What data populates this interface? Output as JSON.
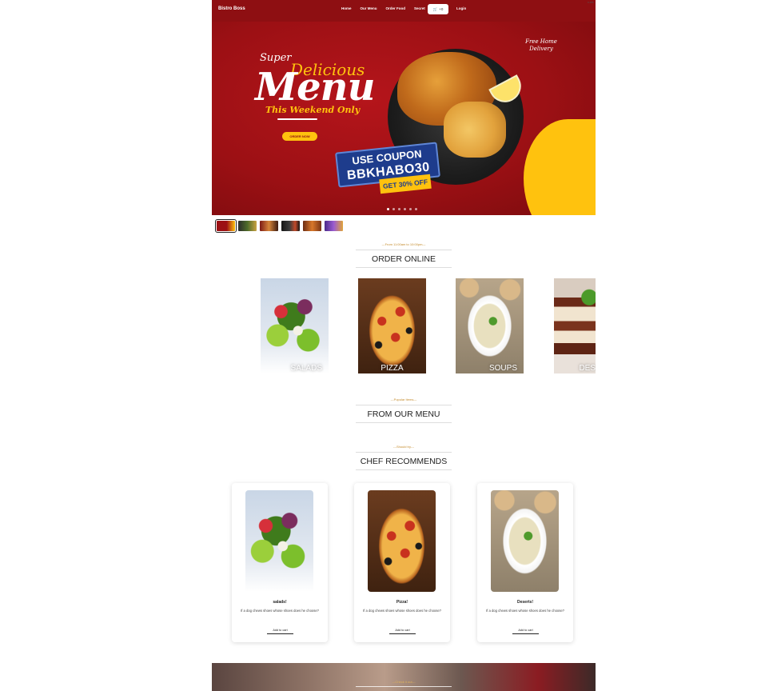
{
  "navbar": {
    "brand": "Bistro Boss",
    "links": [
      "Home",
      "Our Menu",
      "Order Food",
      "Secret"
    ],
    "cart_label": "+0",
    "login_label": "Login",
    "corner_tag": "0 485"
  },
  "hero": {
    "super": "Super",
    "delicious": "Delicious",
    "menu": "Menu",
    "weekend": "This Weekend Only",
    "order_now": "ORDER NOW",
    "free_delivery": "Free Home Delivery",
    "coupon_line1": "USE COUPON",
    "coupon_line2": "BBKHABO30",
    "off_tag": "GET 30% OFF",
    "slides_count": 6,
    "active_slide": 1
  },
  "order_online": {
    "pre": "---From 11:00am to 10:00pm---",
    "title": "ORDER ONLINE",
    "categories": [
      {
        "label": "SALADS",
        "image": "salad"
      },
      {
        "label": "PIZZA",
        "image": "pizza"
      },
      {
        "label": "SOUPS",
        "image": "soup"
      },
      {
        "label": "DES",
        "image": "dessert"
      }
    ]
  },
  "from_menu": {
    "pre": "---Popular Items---",
    "title": "FROM OUR MENU"
  },
  "chef": {
    "pre": "---Should try---",
    "title": "CHEF RECOMMENDS",
    "cards": [
      {
        "title": "salads!",
        "desc": "If a dog chews shoes whose shoes does he choose?",
        "button": "Add to cart",
        "image": "salad"
      },
      {
        "title": "Pizza!",
        "desc": "If a dog chews shoes whose shoes does he choose?",
        "button": "Add to cart",
        "image": "pizza"
      },
      {
        "title": "Deserts!",
        "desc": "If a dog chews shoes whose shoes does he choose?",
        "button": "Add to cart",
        "image": "soup"
      }
    ]
  },
  "bottom_banner": {
    "pre": "---Check it out---"
  },
  "colors": {
    "brand_red": "#8e0f12",
    "accent_yellow": "#ffc20e",
    "heading_gold": "#c48b2c"
  }
}
